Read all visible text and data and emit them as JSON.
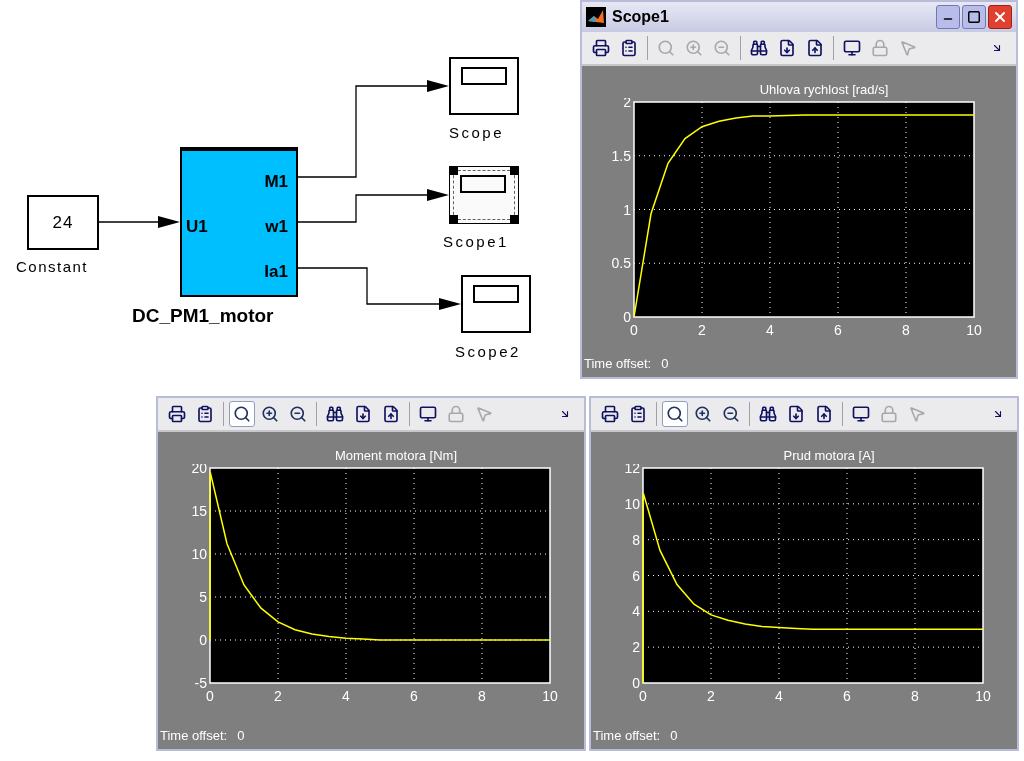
{
  "diagram": {
    "constant": {
      "value": "24",
      "label": "Constant"
    },
    "subsystem": {
      "name": "DC_PM1_motor",
      "inputs": [
        "U1"
      ],
      "outputs": [
        "M1",
        "w1",
        "Ia1"
      ]
    },
    "scopes": [
      {
        "label": "Scope",
        "selected": false
      },
      {
        "label": "Scope1",
        "selected": true
      },
      {
        "label": "Scope2",
        "selected": false
      }
    ]
  },
  "scope_windows": [
    {
      "title_bar": {
        "title": "Scope1"
      },
      "toolbar": [
        {
          "kind": "print",
          "selected": false,
          "disabled": false
        },
        {
          "kind": "properties",
          "selected": false,
          "disabled": false
        },
        {
          "kind": "zoom",
          "selected": false,
          "disabled": true
        },
        {
          "kind": "zoom_x",
          "selected": false,
          "disabled": true
        },
        {
          "kind": "zoom_y",
          "selected": false,
          "disabled": true
        },
        {
          "kind": "autoscale",
          "selected": false,
          "disabled": false
        },
        {
          "kind": "save_axes",
          "selected": false,
          "disabled": false
        },
        {
          "kind": "restore_axes",
          "selected": false,
          "disabled": false
        },
        {
          "kind": "floating",
          "selected": false,
          "disabled": false
        },
        {
          "kind": "lock",
          "selected": false,
          "disabled": true
        },
        {
          "kind": "signal_select",
          "selected": false,
          "disabled": true
        },
        {
          "kind": "dock",
          "selected": false,
          "disabled": false
        }
      ],
      "chart_data": {
        "type": "line",
        "title": "Uhlova rychlost [rad/s]",
        "x": [
          0,
          0.5,
          1,
          1.5,
          2,
          2.5,
          3,
          3.5,
          4,
          5,
          6,
          7,
          8,
          9,
          10
        ],
        "series": [
          {
            "color": "#ffff00",
            "values": [
              0,
              0.96,
              1.43,
              1.66,
              1.77,
              1.82,
              1.85,
              1.87,
              1.87,
              1.88,
              1.88,
              1.88,
              1.88,
              1.88,
              1.88
            ]
          }
        ],
        "grid": true,
        "xlim": [
          0,
          10
        ],
        "ylim": [
          0,
          2
        ],
        "xticks": [
          0,
          2,
          4,
          6,
          8,
          10
        ],
        "yticks": [
          0,
          0.5,
          1,
          1.5,
          2
        ]
      },
      "time_offset": {
        "label": "Time offset:",
        "value": "0"
      }
    },
    {
      "toolbar": [
        {
          "kind": "print",
          "selected": false,
          "disabled": false
        },
        {
          "kind": "properties",
          "selected": false,
          "disabled": false
        },
        {
          "kind": "zoom",
          "selected": true,
          "disabled": false
        },
        {
          "kind": "zoom_x",
          "selected": false,
          "disabled": false
        },
        {
          "kind": "zoom_y",
          "selected": false,
          "disabled": false
        },
        {
          "kind": "autoscale",
          "selected": false,
          "disabled": false
        },
        {
          "kind": "save_axes",
          "selected": false,
          "disabled": false
        },
        {
          "kind": "restore_axes",
          "selected": false,
          "disabled": false
        },
        {
          "kind": "floating",
          "selected": false,
          "disabled": false
        },
        {
          "kind": "lock",
          "selected": false,
          "disabled": true
        },
        {
          "kind": "signal_select",
          "selected": false,
          "disabled": true
        },
        {
          "kind": "dock",
          "selected": false,
          "disabled": false
        }
      ],
      "chart_data": {
        "type": "line",
        "title": "Moment motora [Nm]",
        "x": [
          0,
          0.01,
          0.5,
          1,
          1.5,
          2,
          2.5,
          3,
          3.5,
          4,
          4.5,
          5,
          6,
          7,
          8,
          9,
          10
        ],
        "series": [
          {
            "color": "#ffff00",
            "values": [
              0,
              19.5,
              11.2,
              6.4,
              3.7,
              2.1,
              1.2,
              0.7,
              0.4,
              0.2,
              0.1,
              0,
              0,
              0,
              0,
              0,
              0
            ]
          }
        ],
        "grid": true,
        "xlim": [
          0,
          10
        ],
        "ylim": [
          -5,
          20
        ],
        "xticks": [
          0,
          2,
          4,
          6,
          8,
          10
        ],
        "yticks": [
          -5,
          0,
          5,
          10,
          15,
          20
        ]
      },
      "time_offset": {
        "label": "Time offset:",
        "value": "0"
      }
    },
    {
      "toolbar": [
        {
          "kind": "print",
          "selected": false,
          "disabled": false
        },
        {
          "kind": "properties",
          "selected": false,
          "disabled": false
        },
        {
          "kind": "zoom",
          "selected": true,
          "disabled": false
        },
        {
          "kind": "zoom_x",
          "selected": false,
          "disabled": false
        },
        {
          "kind": "zoom_y",
          "selected": false,
          "disabled": false
        },
        {
          "kind": "autoscale",
          "selected": false,
          "disabled": false
        },
        {
          "kind": "save_axes",
          "selected": false,
          "disabled": false
        },
        {
          "kind": "restore_axes",
          "selected": false,
          "disabled": false
        },
        {
          "kind": "floating",
          "selected": false,
          "disabled": false
        },
        {
          "kind": "lock",
          "selected": false,
          "disabled": true
        },
        {
          "kind": "signal_select",
          "selected": false,
          "disabled": true
        },
        {
          "kind": "dock",
          "selected": false,
          "disabled": false
        }
      ],
      "chart_data": {
        "type": "line",
        "title": "Prud motora [A]",
        "x": [
          0,
          0.01,
          0.5,
          1,
          1.5,
          2,
          2.5,
          3,
          3.5,
          4,
          4.5,
          5,
          6,
          7,
          8,
          9,
          10
        ],
        "series": [
          {
            "color": "#ffff00",
            "values": [
              0,
              10.6,
              7.4,
              5.5,
              4.4,
              3.8,
              3.5,
              3.3,
              3.15,
              3.1,
              3.05,
              3,
              3,
              3,
              3,
              3,
              3
            ]
          }
        ],
        "grid": true,
        "xlim": [
          0,
          10
        ],
        "ylim": [
          0,
          12
        ],
        "xticks": [
          0,
          2,
          4,
          6,
          8,
          10
        ],
        "yticks": [
          0,
          2,
          4,
          6,
          8,
          10,
          12
        ]
      },
      "time_offset": {
        "label": "Time offset:",
        "value": "0"
      }
    }
  ]
}
